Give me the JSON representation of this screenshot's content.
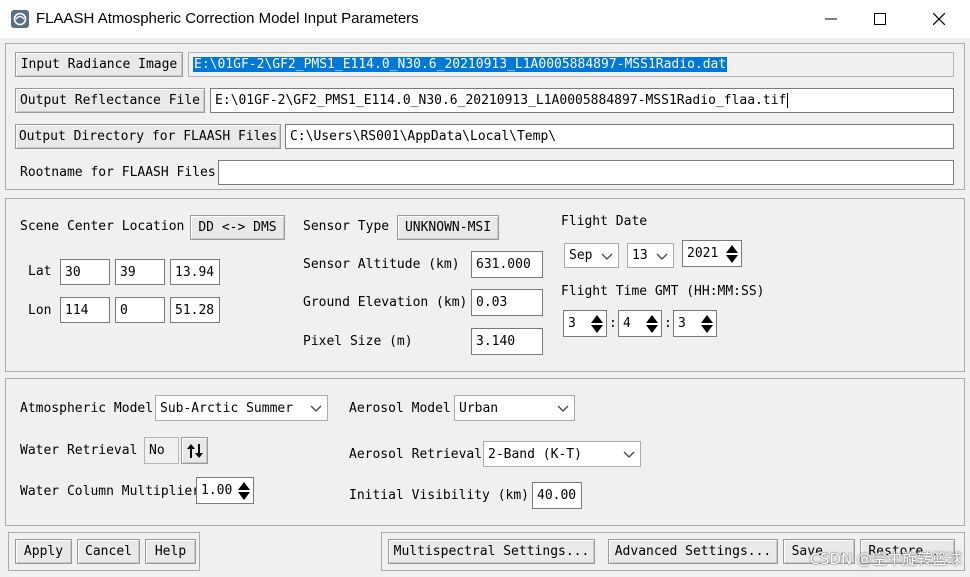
{
  "window": {
    "title": "FLAASH Atmospheric Correction Model Input Parameters",
    "minimize_icon": "minimize-icon",
    "maximize_icon": "maximize-icon",
    "close_icon": "close-icon"
  },
  "files": {
    "input_radiance_label": "Input Radiance Image",
    "input_radiance_value": "E:\\01GF-2\\GF2_PMS1_E114.0_N30.6_20210913_L1A0005884897-MSS1Radio.dat",
    "output_reflectance_label": "Output Reflectance File",
    "output_reflectance_value": "E:\\01GF-2\\GF2_PMS1_E114.0_N30.6_20210913_L1A0005884897-MSS1Radio_flaa.tif",
    "output_directory_label": "Output Directory for FLAASH Files",
    "output_directory_value": "C:\\Users\\RS001\\AppData\\Local\\Temp\\",
    "rootname_label": "Rootname for FLAASH Files",
    "rootname_value": ""
  },
  "scene": {
    "center_location_label": "Scene Center Location",
    "dd_dms_button": "DD <-> DMS",
    "lat_label": "Lat",
    "lat": [
      "30",
      "39",
      "13.94"
    ],
    "lon_label": "Lon",
    "lon": [
      "114",
      "0",
      "51.28"
    ],
    "sensor_type_label": "Sensor Type",
    "sensor_type_button": "UNKNOWN-MSI",
    "sensor_altitude_label": "Sensor Altitude (km)",
    "sensor_altitude": "631.000",
    "ground_elevation_label": "Ground Elevation (km)",
    "ground_elevation": "0.03",
    "pixel_size_label": "Pixel Size (m)",
    "pixel_size": "3.140",
    "flight_date_label": "Flight Date",
    "flight_month": "Sep",
    "flight_day": "13",
    "flight_year": "2021",
    "flight_time_label": "Flight Time GMT (HH:MM:SS)",
    "flight_hh": "3",
    "flight_mm": "4",
    "flight_ss": "3",
    "time_sep": ":"
  },
  "atmosphere": {
    "atmospheric_model_label": "Atmospheric Model",
    "atmospheric_model": "Sub-Arctic Summer",
    "water_retrieval_label": "Water Retrieval",
    "water_retrieval": "No",
    "water_column_label": "Water Column Multiplier",
    "water_column": "1.00",
    "aerosol_model_label": "Aerosol Model",
    "aerosol_model": "Urban",
    "aerosol_retrieval_label": "Aerosol Retrieval",
    "aerosol_retrieval": "2-Band (K-T)",
    "initial_visibility_label": "Initial Visibility (km)",
    "initial_visibility": "40.00"
  },
  "buttons": {
    "apply": "Apply",
    "cancel": "Cancel",
    "help": "Help",
    "multispectral": "Multispectral Settings...",
    "advanced": "Advanced Settings...",
    "save": "Save...",
    "restore": "Restore..."
  },
  "watermark": "CSDN @空中旋转篮球"
}
